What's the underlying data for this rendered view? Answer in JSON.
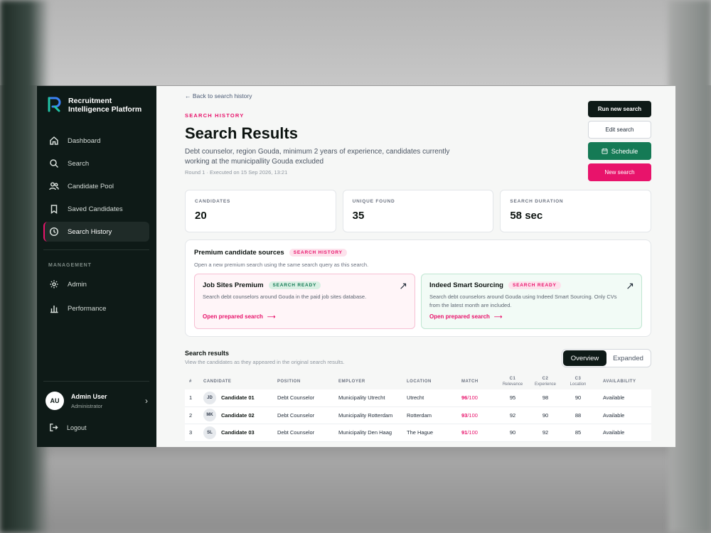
{
  "brand": {
    "name_line1": "Recruitment",
    "name_line2": "Intelligence Platform"
  },
  "sidebar": {
    "items": [
      {
        "label": "Dashboard",
        "icon": "home-icon"
      },
      {
        "label": "Search",
        "icon": "search-icon"
      },
      {
        "label": "Candidate Pool",
        "icon": "users-icon"
      },
      {
        "label": "Saved Candidates",
        "icon": "bookmark-icon"
      },
      {
        "label": "Search History",
        "icon": "clock-icon",
        "active": true
      }
    ],
    "management_label": "MANAGEMENT",
    "management_items": [
      {
        "label": "Admin",
        "icon": "gear-icon"
      },
      {
        "label": "Performance",
        "icon": "bar-chart-icon"
      }
    ],
    "user": {
      "initials": "AU",
      "name": "Admin User",
      "role": "Administrator"
    },
    "logout_label": "Logout"
  },
  "header": {
    "back_link": "← Back to search history",
    "eyebrow": "SEARCH HISTORY",
    "title": "Search Results",
    "description": "Debt counselor, region Gouda, minimum 2 years of experience, candidates currently working at the municipallity Gouda excluded",
    "meta": "Round 1 · Executed on 15 Sep 2026, 13:21"
  },
  "actions": {
    "run_new": "Run new search",
    "edit": "Edit search",
    "schedule": "Schedule",
    "new_search": "New search"
  },
  "stats": [
    {
      "label": "CANDIDATES",
      "value": "20"
    },
    {
      "label": "UNIQUE FOUND",
      "value": "35"
    },
    {
      "label": "SEARCH DURATION",
      "value": "58 sec"
    }
  ],
  "premium": {
    "title": "Premium candidate sources",
    "badge": "SEARCH HISTORY",
    "subtitle": "Open a new premium search using the same search query as this search.",
    "cards": [
      {
        "title": "Job Sites Premium",
        "badge": "SEARCH READY",
        "description": "Search debt counselors around Gouda in the paid job sites database.",
        "link": "Open prepared search"
      },
      {
        "title": "Indeed Smart Sourcing",
        "badge": "SEARCH READY",
        "description": "Search debt counselors around Gouda using Indeed Smart Sourcing. Only CVs from the latest month are included.",
        "link": "Open prepared search"
      }
    ]
  },
  "results": {
    "title": "Search results",
    "subtitle": "View the candidates as they appeared in the original search results.",
    "toggle": {
      "overview": "Overview",
      "expanded": "Expanded"
    },
    "columns": {
      "num": "#",
      "candidate": "CANDIDATE",
      "position": "POSITION",
      "employer": "EMPLOYER",
      "location": "LOCATION",
      "match": "MATCH",
      "c1": "C1",
      "c1_sub": "Relevance",
      "c2": "C2",
      "c2_sub": "Experience",
      "c3": "C3",
      "c3_sub": "Location",
      "availability": "AVAILABILITY"
    },
    "rows": [
      {
        "num": "1",
        "initials": "JD",
        "name": "Candidate 01",
        "position": "Debt Counselor",
        "employer": "Municipality Utrecht",
        "location": "Utrecht",
        "match": "96",
        "match_max": "/100",
        "c1": "95",
        "c2": "98",
        "c3": "90",
        "availability": "Available"
      },
      {
        "num": "2",
        "initials": "MK",
        "name": "Candidate 02",
        "position": "Debt Counselor",
        "employer": "Municipality Rotterdam",
        "location": "Rotterdam",
        "match": "93",
        "match_max": "/100",
        "c1": "92",
        "c2": "90",
        "c3": "88",
        "availability": "Available"
      },
      {
        "num": "3",
        "initials": "SL",
        "name": "Candidate 03",
        "position": "Debt Counselor",
        "employer": "Municipality Den Haag",
        "location": "The Hague",
        "match": "91",
        "match_max": "/100",
        "c1": "90",
        "c2": "92",
        "c3": "85",
        "availability": "Available"
      }
    ]
  },
  "colors": {
    "accent": "#e8136b",
    "sidebar": "#0e1a17",
    "success": "#157a55"
  }
}
